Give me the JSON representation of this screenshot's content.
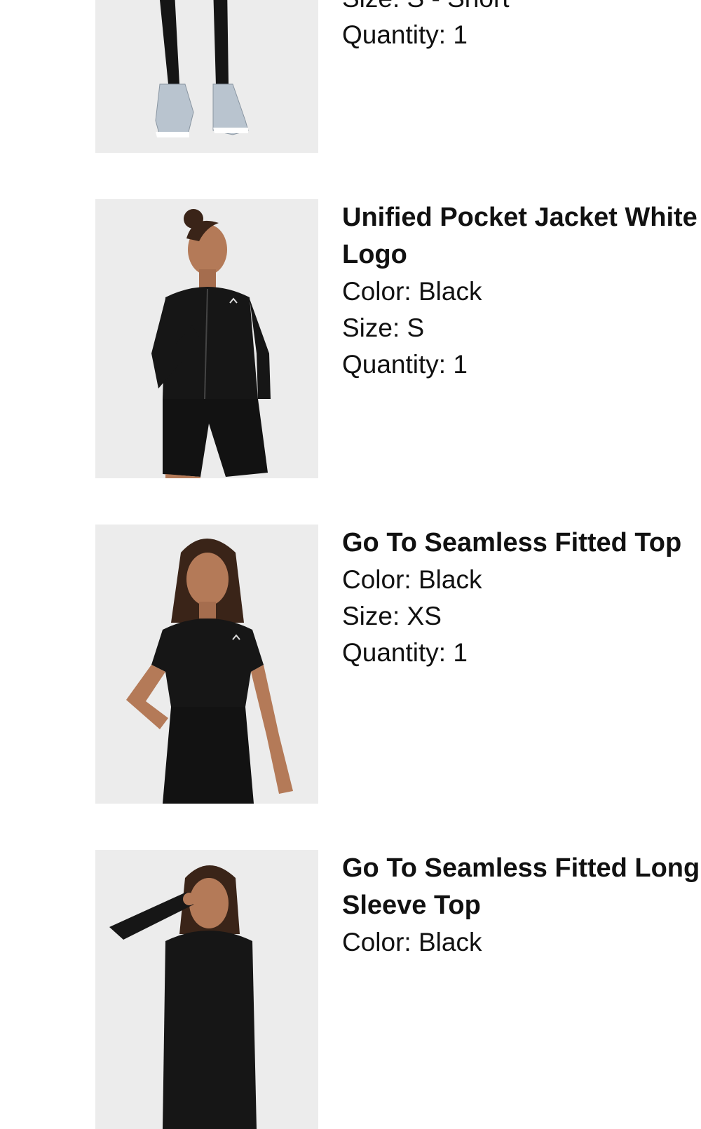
{
  "items": [
    {
      "title": "",
      "attributes": [
        {
          "label": "Size:",
          "value": "S - Short"
        },
        {
          "label": "Quantity:",
          "value": "1"
        }
      ],
      "image": "product-photo-leggings"
    },
    {
      "title": "Unified Pocket Jacket White Logo",
      "attributes": [
        {
          "label": "Color:",
          "value": "Black"
        },
        {
          "label": "Size:",
          "value": "S"
        },
        {
          "label": "Quantity:",
          "value": "1"
        }
      ],
      "image": "product-photo-jacket"
    },
    {
      "title": "Go To Seamless Fitted Top",
      "attributes": [
        {
          "label": "Color:",
          "value": "Black"
        },
        {
          "label": "Size:",
          "value": "XS"
        },
        {
          "label": "Quantity:",
          "value": "1"
        }
      ],
      "image": "product-photo-fitted-top"
    },
    {
      "title": "Go To Seamless Fitted Long Sleeve Top",
      "attributes": [
        {
          "label": "Color:",
          "value": "Black"
        }
      ],
      "image": "product-photo-long-sleeve-top"
    }
  ]
}
